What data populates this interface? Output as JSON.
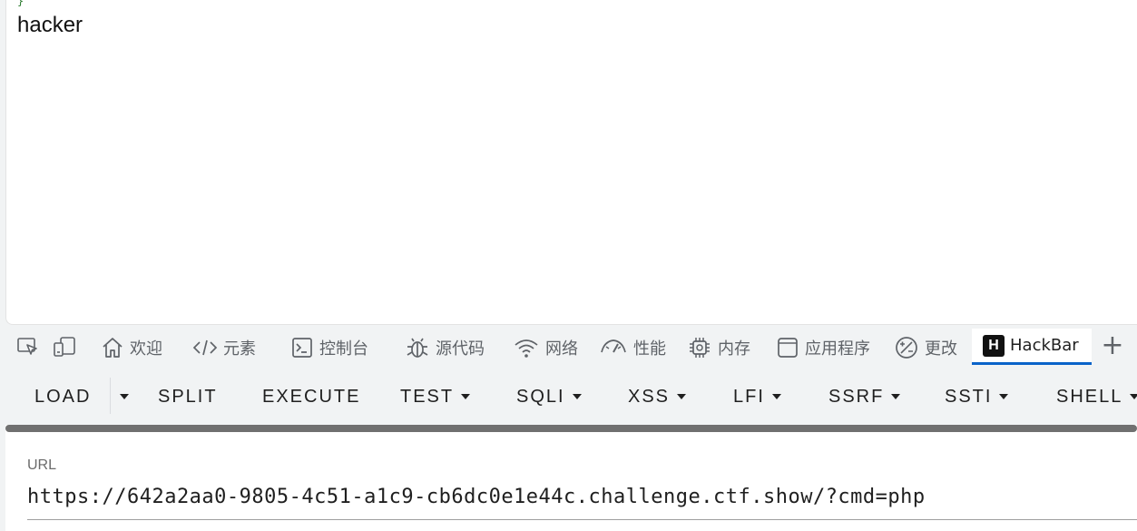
{
  "page": {
    "brace": "}",
    "text": "hacker"
  },
  "devtools": {
    "tabs": [
      {
        "label": "欢迎",
        "icon": "home-icon"
      },
      {
        "label": "元素",
        "icon": "code-icon"
      },
      {
        "label": "控制台",
        "icon": "console-icon"
      },
      {
        "label": "源代码",
        "icon": "bug-icon"
      },
      {
        "label": "网络",
        "icon": "wifi-icon"
      },
      {
        "label": "性能",
        "icon": "gauge-icon"
      },
      {
        "label": "内存",
        "icon": "chip-icon"
      },
      {
        "label": "应用程序",
        "icon": "window-icon"
      },
      {
        "label": "更改",
        "icon": "changes-icon"
      },
      {
        "label": "HackBar",
        "icon": "hackbar-logo-icon",
        "active": true
      }
    ],
    "logo_letter": "H",
    "add_tab": "+"
  },
  "hackbar": {
    "buttons": {
      "load": "LOAD",
      "split": "SPLIT",
      "execute": "EXECUTE",
      "test": "TEST",
      "sqli": "SQLI",
      "xss": "XSS",
      "lfi": "LFI",
      "ssrf": "SSRF",
      "ssti": "SSTI",
      "shell": "SHELL"
    },
    "url_label": "URL",
    "url_value": "https://642a2aa0-9805-4c51-a1c9-cb6dc0e1e44c.challenge.ctf.show/?cmd=php"
  },
  "colors": {
    "active_tab_underline": "#0a63c9",
    "progress_bar": "#707070"
  }
}
